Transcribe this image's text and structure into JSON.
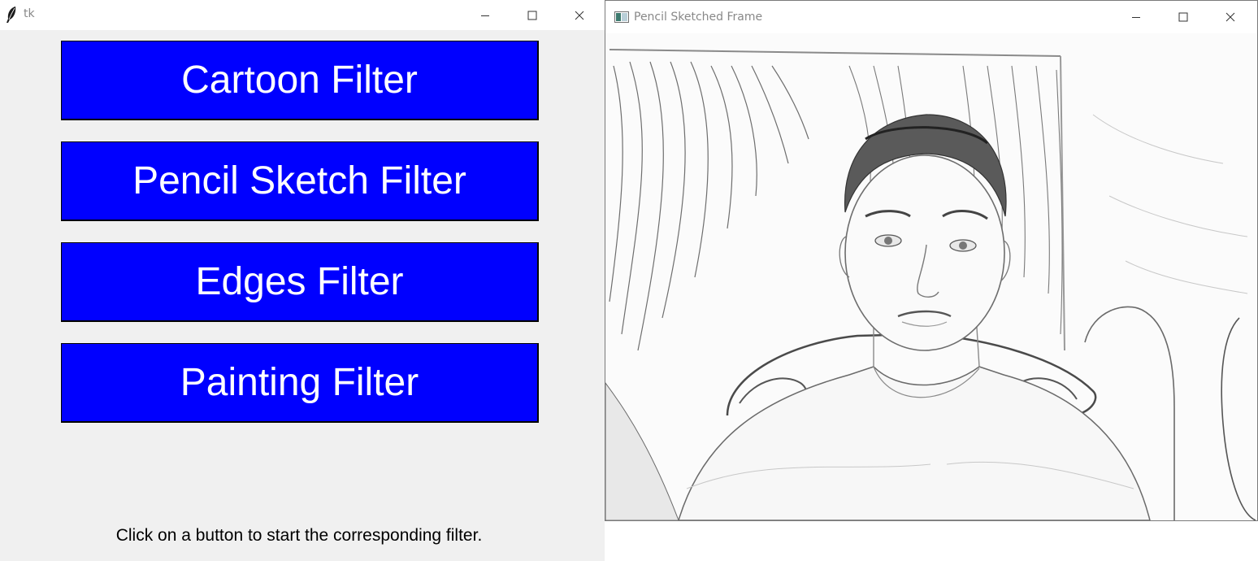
{
  "tk_window": {
    "title": "tk",
    "buttons": [
      {
        "label": "Cartoon Filter"
      },
      {
        "label": "Pencil Sketch Filter"
      },
      {
        "label": "Edges Filter"
      },
      {
        "label": "Painting Filter"
      }
    ],
    "status": "Click on a button to start the corresponding filter.",
    "button_color": "#0000ff"
  },
  "frame_window": {
    "title": "Pencil Sketched Frame",
    "image": "pencil-sketch-webcam-portrait"
  },
  "window_controls": [
    "minimize-icon",
    "maximize-icon",
    "close-icon"
  ]
}
